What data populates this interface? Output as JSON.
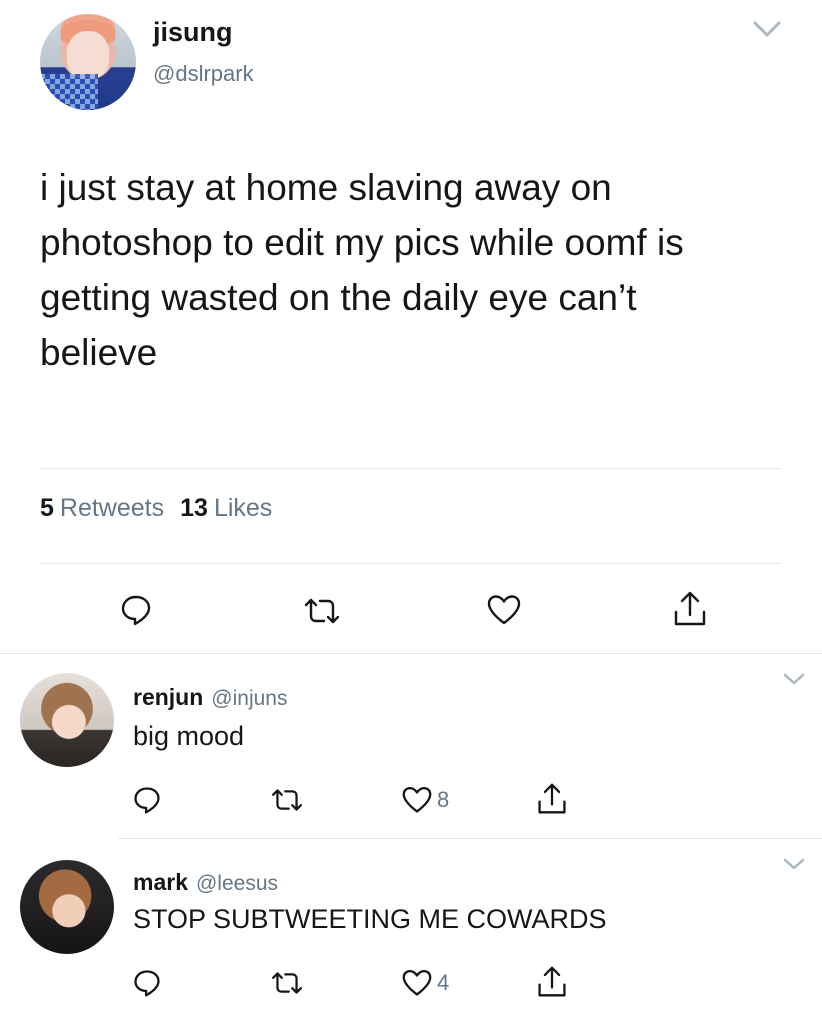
{
  "tweet": {
    "author_name": "jisung",
    "author_handle": "@dslrpark",
    "text": "i just stay at home slaving away on\nphotoshop to edit my pics while oomf is\ngetting wasted on the daily eye can’t\nbelieve",
    "retweet_count": "5",
    "retweet_label": "Retweets",
    "like_count": "13",
    "like_label": "Likes"
  },
  "replies": [
    {
      "name": "renjun",
      "handle": "@injuns",
      "text": "big mood",
      "like_count": "8"
    },
    {
      "name": "mark",
      "handle": "@leesus",
      "text": "STOP SUBTWEETING ME COWARDS",
      "like_count": "4"
    }
  ],
  "icons": {
    "more": "chevron-down-icon",
    "reply": "reply-icon",
    "retweet": "retweet-icon",
    "like": "heart-icon",
    "share": "share-icon"
  },
  "colors": {
    "text": "#14171a",
    "secondary": "#657786",
    "divider": "#e1e8ed"
  }
}
